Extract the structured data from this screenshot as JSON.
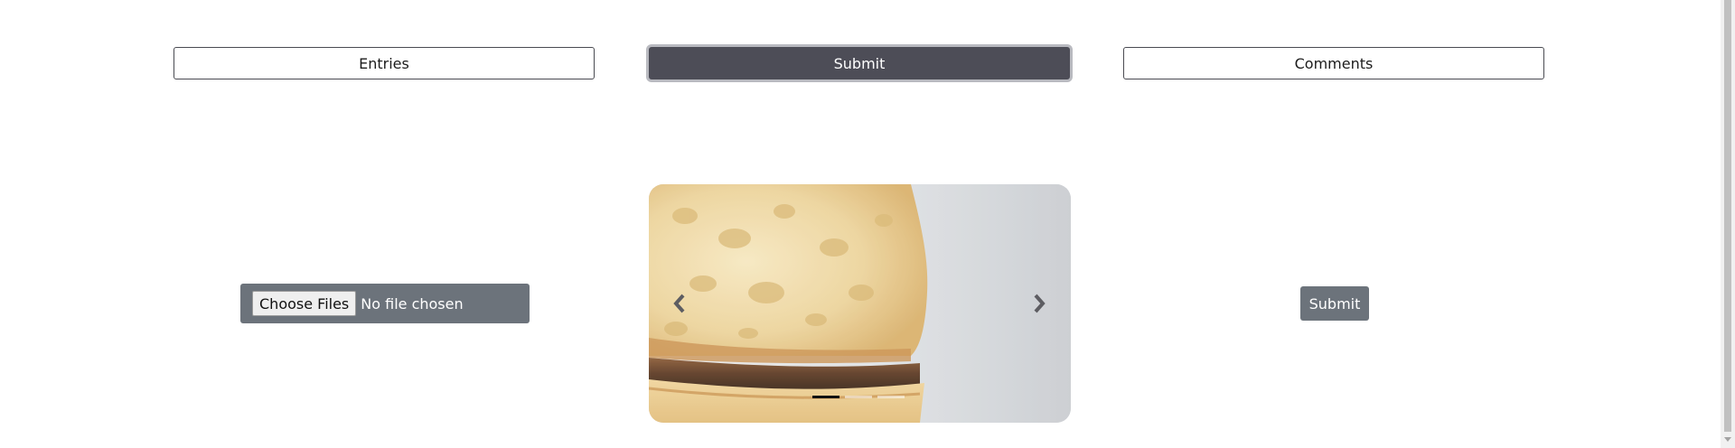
{
  "nav": {
    "entries_label": "Entries",
    "submit_label": "Submit",
    "comments_label": "Comments",
    "active": "Submit"
  },
  "upload": {
    "choose_label": "Choose Files",
    "status_text": "No file chosen"
  },
  "carousel": {
    "image_icon": "croissant-photo",
    "prev_icon": "chevron-left-icon",
    "next_icon": "chevron-right-icon",
    "slide_count": 3,
    "active_slide": 1
  },
  "actions": {
    "submit_label": "Submit"
  },
  "colors": {
    "active_nav": "#4d4d57",
    "secondary_button": "#6c737b",
    "nav_border": "#4a4b52"
  }
}
